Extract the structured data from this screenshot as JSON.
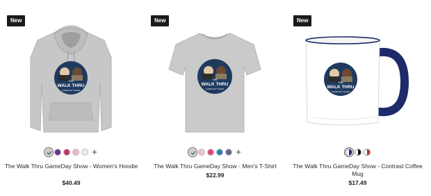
{
  "products": [
    {
      "badge": "New",
      "title": "The Walk Thru GameDay Show - Women's Hoodie",
      "price": "$40.49",
      "logo_text_1": "THE",
      "logo_text_2": "WALK THRU",
      "logo_text_3": "GAME DAY SHOW",
      "colors": [
        "#c9c9c9",
        "#6a2f8f",
        "#c2336b",
        "#f2b4c9",
        "#ececec"
      ],
      "selected_color": 0
    },
    {
      "badge": "New",
      "title": "The Walk Thru GameDay Show - Men's T-Shirt",
      "price": "$22.99",
      "logo_text_1": "THE",
      "logo_text_2": "WALK THRU",
      "logo_text_3": "GAME DAY SHOW",
      "colors": [
        "#cfcfcf",
        "#f2c1d1",
        "#e0487f",
        "#2f7fb3",
        "#5c6a8a"
      ],
      "selected_color": 0
    },
    {
      "badge": "New",
      "title": "The Walk Thru GameDay Show - Contrast Coffee Mug",
      "price": "$17.49",
      "logo_text_1": "THE",
      "logo_text_2": "WALK THRU",
      "logo_text_3": "GAME DAY SHOW",
      "mug_colors": [
        [
          "#ffffff",
          "#1f2a6b"
        ],
        [
          "#ffffff",
          "#111111"
        ],
        [
          "#ffffff",
          "#c0302b"
        ]
      ],
      "selected_color": 0
    }
  ],
  "more_colors_symbol": "+"
}
